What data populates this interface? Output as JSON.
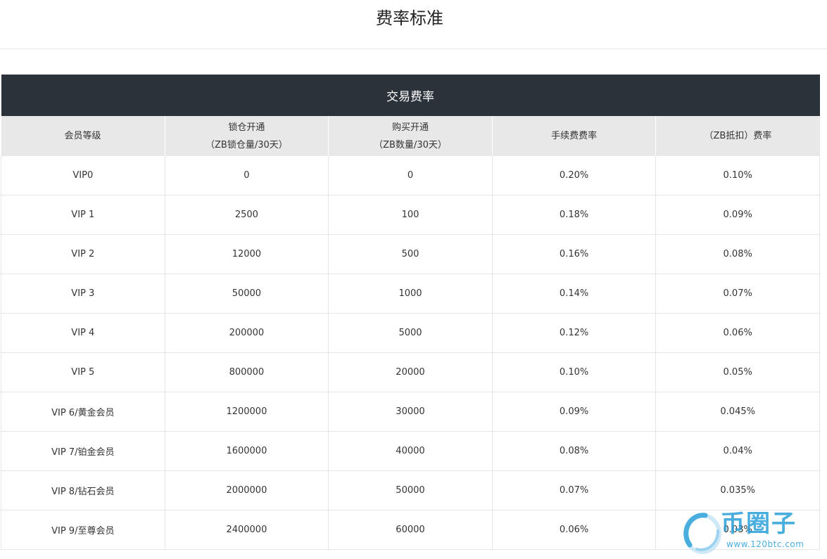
{
  "page_title": "费率标准",
  "table": {
    "caption": "交易费率",
    "headers": [
      {
        "line1": "会员等级",
        "line2": ""
      },
      {
        "line1": "锁仓开通",
        "line2": "（ZB锁仓量/30天）"
      },
      {
        "line1": "购买开通",
        "line2": "（ZB数量/30天）"
      },
      {
        "line1": "手续费费率",
        "line2": ""
      },
      {
        "line1": "（ZB抵扣）费率",
        "line2": ""
      }
    ],
    "rows": [
      [
        "VIP0",
        "0",
        "0",
        "0.20%",
        "0.10%"
      ],
      [
        "VIP 1",
        "2500",
        "100",
        "0.18%",
        "0.09%"
      ],
      [
        "VIP 2",
        "12000",
        "500",
        "0.16%",
        "0.08%"
      ],
      [
        "VIP 3",
        "50000",
        "1000",
        "0.14%",
        "0.07%"
      ],
      [
        "VIP 4",
        "200000",
        "5000",
        "0.12%",
        "0.06%"
      ],
      [
        "VIP 5",
        "800000",
        "20000",
        "0.10%",
        "0.05%"
      ],
      [
        "VIP 6/黄金会员",
        "1200000",
        "30000",
        "0.09%",
        "0.045%"
      ],
      [
        "VIP 7/铂金会员",
        "1600000",
        "40000",
        "0.08%",
        "0.04%"
      ],
      [
        "VIP 8/钻石会员",
        "2000000",
        "50000",
        "0.07%",
        "0.035%"
      ],
      [
        "VIP 9/至尊会员",
        "2400000",
        "60000",
        "0.06%",
        "0.03%"
      ]
    ]
  },
  "watermark": {
    "text": "币圈子",
    "url": "www.120btc.com",
    "color": "#2a9fd8",
    "icon": "ring-logo-icon"
  },
  "colors": {
    "caption_bg": "#2b323a",
    "header_bg": "#e8e8e8",
    "border": "#e5e5e5"
  }
}
